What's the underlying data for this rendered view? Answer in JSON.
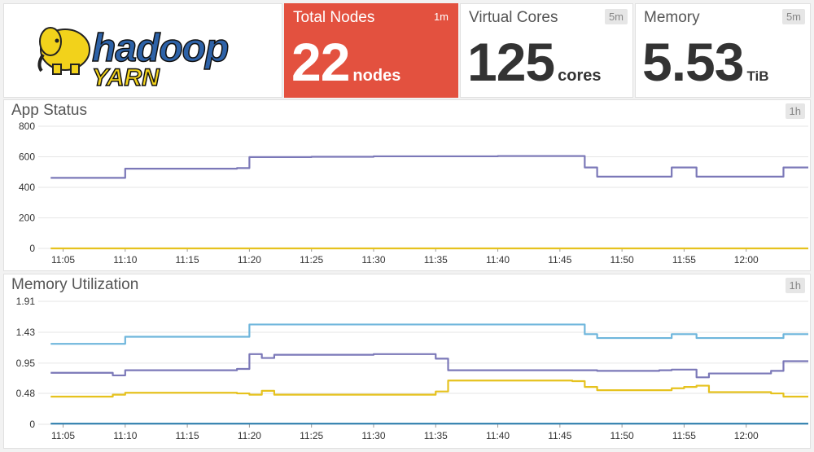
{
  "logo": {
    "primary": "hadoop",
    "secondary": "YARN"
  },
  "stats": {
    "total_nodes": {
      "title": "Total Nodes",
      "interval": "1m",
      "value": "22",
      "unit": "nodes"
    },
    "virtual_cores": {
      "title": "Virtual Cores",
      "interval": "5m",
      "value": "125",
      "unit": "cores"
    },
    "memory": {
      "title": "Memory",
      "interval": "5m",
      "value": "5.53",
      "unit": "TiB"
    }
  },
  "colors": {
    "alert_red": "#e3513f",
    "purple": "#7b78b8",
    "yellow": "#e6c21e",
    "light_blue": "#6fb6dc",
    "dark_blue": "#2e7fae"
  },
  "app_status": {
    "title": "App Status",
    "interval": "1h",
    "chart_data": {
      "type": "line",
      "x": [
        "11:04",
        "11:08",
        "11:09",
        "11:10",
        "11:19",
        "11:20",
        "11:25",
        "11:30",
        "11:35",
        "11:40",
        "11:46",
        "11:47",
        "11:48",
        "11:53",
        "11:54",
        "11:56",
        "12:02",
        "12:03"
      ],
      "y_ticks": [
        "0",
        "200",
        "400",
        "600",
        "800"
      ],
      "x_ticks": [
        "11:05",
        "11:10",
        "11:15",
        "11:20",
        "11:25",
        "11:30",
        "11:35",
        "11:40",
        "11:45",
        "11:50",
        "11:55",
        "12:00"
      ],
      "ylim": [
        0,
        800
      ],
      "series": [
        {
          "color": "#7b78b8",
          "values": [
            462,
            462,
            462,
            522,
            526,
            598,
            600,
            603,
            603,
            605,
            605,
            530,
            470,
            470,
            530,
            470,
            470,
            530
          ]
        },
        {
          "color": "#e6c21e",
          "values": [
            0,
            0,
            0,
            0,
            0,
            0,
            0,
            0,
            0,
            0,
            0,
            0,
            0,
            0,
            0,
            0,
            0,
            0
          ]
        }
      ]
    }
  },
  "memory_utilization": {
    "title": "Memory Utilization",
    "interval": "1h",
    "chart_data": {
      "type": "line",
      "x": [
        "11:04",
        "11:08",
        "11:09",
        "11:10",
        "11:19",
        "11:20",
        "11:21",
        "11:22",
        "11:30",
        "11:34",
        "11:35",
        "11:36",
        "11:46",
        "11:47",
        "11:48",
        "11:53",
        "11:54",
        "11:55",
        "11:56",
        "11:57",
        "12:02",
        "12:03"
      ],
      "y_ticks": [
        "0",
        "0.48",
        "0.95",
        "1.43",
        "1.91"
      ],
      "x_ticks": [
        "11:05",
        "11:10",
        "11:15",
        "11:20",
        "11:25",
        "11:30",
        "11:35",
        "11:40",
        "11:45",
        "11:50",
        "11:55",
        "12:00"
      ],
      "ylim": [
        0,
        1.91
      ],
      "series": [
        {
          "color": "#6fb6dc",
          "values": [
            1.25,
            1.25,
            1.25,
            1.36,
            1.36,
            1.55,
            1.55,
            1.55,
            1.55,
            1.55,
            1.55,
            1.55,
            1.55,
            1.4,
            1.34,
            1.34,
            1.4,
            1.4,
            1.34,
            1.34,
            1.34,
            1.4
          ]
        },
        {
          "color": "#7b78b8",
          "values": [
            0.8,
            0.8,
            0.76,
            0.84,
            0.86,
            1.09,
            1.03,
            1.08,
            1.09,
            1.09,
            1.02,
            0.84,
            0.84,
            0.84,
            0.83,
            0.84,
            0.85,
            0.85,
            0.73,
            0.79,
            0.83,
            0.98
          ]
        },
        {
          "color": "#e6c21e",
          "values": [
            0.43,
            0.43,
            0.46,
            0.49,
            0.48,
            0.46,
            0.52,
            0.46,
            0.46,
            0.46,
            0.51,
            0.68,
            0.67,
            0.58,
            0.53,
            0.53,
            0.56,
            0.58,
            0.6,
            0.5,
            0.48,
            0.43
          ]
        },
        {
          "color": "#2e7fae",
          "values": [
            0.01,
            0.01,
            0.01,
            0.01,
            0.01,
            0.01,
            0.01,
            0.01,
            0.01,
            0.01,
            0.01,
            0.01,
            0.01,
            0.01,
            0.01,
            0.01,
            0.01,
            0.01,
            0.01,
            0.01,
            0.01,
            0.01
          ]
        }
      ]
    }
  }
}
